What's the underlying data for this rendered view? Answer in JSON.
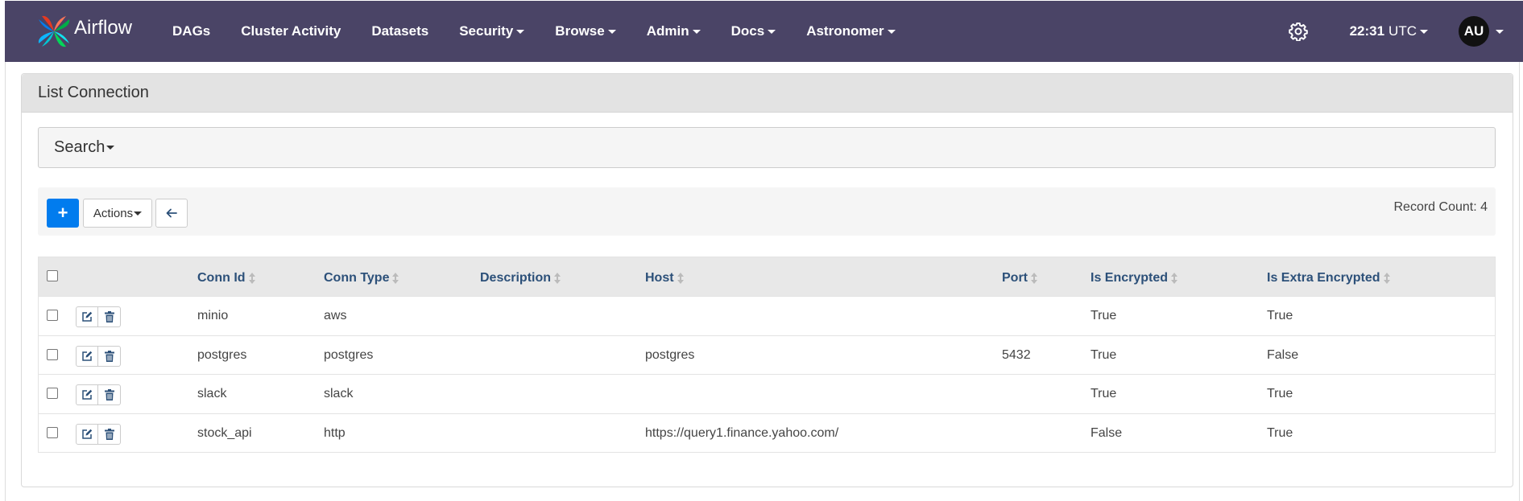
{
  "navbar": {
    "brand": "Airflow",
    "links": [
      "DAGs",
      "Cluster Activity",
      "Datasets",
      "Security",
      "Browse",
      "Admin",
      "Docs",
      "Astronomer"
    ],
    "dropdown_links": [
      false,
      false,
      false,
      true,
      true,
      true,
      true,
      true
    ],
    "time": "22:31",
    "timezone": "UTC",
    "avatar": "AU"
  },
  "panel": {
    "title": "List Connection",
    "search_label": "Search",
    "actions_label": "Actions",
    "add_label": "+",
    "record_count": "Record Count: 4"
  },
  "table": {
    "columns": [
      "Conn Id",
      "Conn Type",
      "Description",
      "Host",
      "Port",
      "Is Encrypted",
      "Is Extra Encrypted"
    ],
    "rows": [
      {
        "conn_id": "minio",
        "conn_type": "aws",
        "description": "",
        "host": "",
        "port": "",
        "is_encrypted": "True",
        "is_extra_encrypted": "True"
      },
      {
        "conn_id": "postgres",
        "conn_type": "postgres",
        "description": "",
        "host": "postgres",
        "port": "5432",
        "is_encrypted": "True",
        "is_extra_encrypted": "False"
      },
      {
        "conn_id": "slack",
        "conn_type": "slack",
        "description": "",
        "host": "",
        "port": "",
        "is_encrypted": "True",
        "is_extra_encrypted": "True"
      },
      {
        "conn_id": "stock_api",
        "conn_type": "http",
        "description": "",
        "host": "https://query1.finance.yahoo.com/",
        "port": "",
        "is_encrypted": "False",
        "is_extra_encrypted": "True"
      }
    ]
  },
  "colors": {
    "navbar_bg": "#4a4466",
    "primary": "#017cee",
    "header_link": "#2c5079"
  }
}
